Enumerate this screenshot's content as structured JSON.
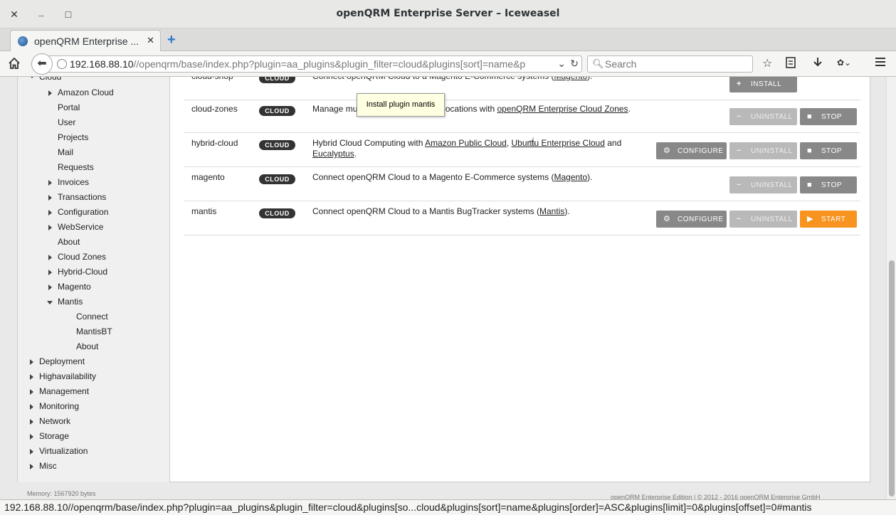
{
  "window": {
    "title": "openQRM Enterprise Server – Iceweasel",
    "close_glyph": "✕",
    "minimize_glyph": "_",
    "maximize_glyph": "□"
  },
  "tab": {
    "label": "openQRM Enterprise ...",
    "close_glyph": "✕",
    "new_glyph": "+"
  },
  "navbar": {
    "url_host": "192.168.88.10",
    "url_path": "//openqrm/base/index.php?plugin=aa_plugins&plugin_filter=cloud&plugins[sort]=name&p",
    "search_placeholder": "Search"
  },
  "sidebar": {
    "top_partial": "Cloud",
    "cloud_children": [
      {
        "label": "Amazon Cloud",
        "expandable": true
      },
      {
        "label": "Portal",
        "expandable": false
      },
      {
        "label": "User",
        "expandable": false
      },
      {
        "label": "Projects",
        "expandable": false
      },
      {
        "label": "Mail",
        "expandable": false
      },
      {
        "label": "Requests",
        "expandable": false
      },
      {
        "label": "Invoices",
        "expandable": true
      },
      {
        "label": "Transactions",
        "expandable": true
      },
      {
        "label": "Configuration",
        "expandable": true
      },
      {
        "label": "WebService",
        "expandable": true
      },
      {
        "label": "About",
        "expandable": false
      },
      {
        "label": "Cloud Zones",
        "expandable": true
      },
      {
        "label": "Hybrid-Cloud",
        "expandable": true
      },
      {
        "label": "Magento",
        "expandable": true
      },
      {
        "label": "Mantis",
        "expandable": true,
        "expanded": true
      }
    ],
    "mantis_children": [
      "Connect",
      "MantisBT",
      "About"
    ],
    "top_level": [
      "Deployment",
      "Highavailability",
      "Management",
      "Monitoring",
      "Network",
      "Storage",
      "Virtualization",
      "Misc"
    ]
  },
  "plugins": [
    {
      "name": "cloud-shop",
      "badge": "CLOUD",
      "desc_parts": [
        "Connect openQRM Cloud to a Magento E-Commerce systems (",
        "Magento",
        ")."
      ],
      "buttons": [
        {
          "kind": "install",
          "label": "INSTALL",
          "icon": "+"
        }
      ]
    },
    {
      "name": "cloud-zones",
      "badge": "CLOUD",
      "desc_parts": [
        "Manage multiple openQRM Cloud locations with ",
        "openQRM Enterprise Cloud Zones",
        "."
      ],
      "buttons": [
        {
          "kind": "uninstall",
          "label": "UNINSTALL",
          "icon": "−"
        },
        {
          "kind": "stop",
          "label": "STOP",
          "icon": "■"
        }
      ]
    },
    {
      "name": "hybrid-cloud",
      "badge": "CLOUD",
      "desc_parts": [
        "Hybrid Cloud Computing with ",
        "Amazon Public Cloud",
        ", ",
        "Ubuntu Enterprise Cloud",
        " and ",
        "Eucalyptus",
        "."
      ],
      "buttons": [
        {
          "kind": "configure",
          "label": "CONFIGURE",
          "icon": "⚙"
        },
        {
          "kind": "uninstall",
          "label": "UNINSTALL",
          "icon": "−"
        },
        {
          "kind": "stop",
          "label": "STOP",
          "icon": "■"
        }
      ]
    },
    {
      "name": "magento",
      "badge": "CLOUD",
      "desc_parts": [
        "Connect openQRM Cloud to a Magento E-Commerce systems (",
        "Magento",
        ")."
      ],
      "buttons": [
        {
          "kind": "uninstall",
          "label": "UNINSTALL",
          "icon": "−"
        },
        {
          "kind": "stop",
          "label": "STOP",
          "icon": "■"
        }
      ]
    },
    {
      "name": "mantis",
      "badge": "CLOUD",
      "desc_parts": [
        "Connect openQRM Cloud to a Mantis BugTracker systems (",
        "Mantis",
        ")."
      ],
      "buttons": [
        {
          "kind": "configure",
          "label": "CONFIGURE",
          "icon": "⚙"
        },
        {
          "kind": "uninstall",
          "label": "UNINSTALL",
          "icon": "−"
        },
        {
          "kind": "start",
          "label": "START",
          "icon": "▶"
        }
      ]
    }
  ],
  "tooltip": "Install plugin mantis",
  "footer": {
    "memory": "Memory: 1567920 bytes",
    "copyright": "openQRM Enterprise Edition | © 2012 - 2016 openQRM Enterprise GmbH"
  },
  "statusbar": "192.168.88.10//openqrm/base/index.php?plugin=aa_plugins&plugin_filter=cloud&plugins[so...cloud&plugins[sort]=name&plugins[order]=ASC&plugins[limit]=0&plugins[offset]=0#mantis",
  "colors": {
    "start": "#f7931e",
    "badge": "#333333",
    "uninstall": "#b9b9b9",
    "stop": "#888888"
  }
}
